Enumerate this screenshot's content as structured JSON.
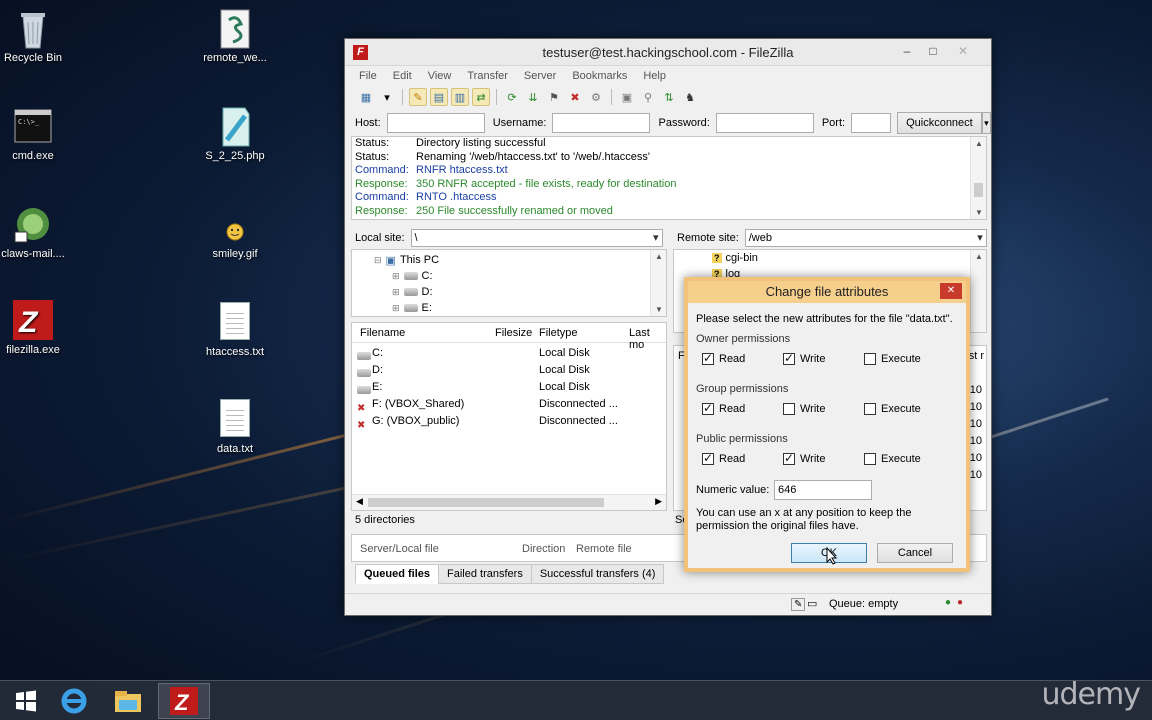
{
  "desktop": {
    "icons": [
      {
        "label": "Recycle Bin",
        "icon": "recycle-bin-icon"
      },
      {
        "label": "remote_we...",
        "icon": "script-file-icon"
      },
      {
        "label": "cmd.exe",
        "icon": "console-icon"
      },
      {
        "label": "S_2_25.php",
        "icon": "php-file-icon"
      },
      {
        "label": "claws-mail....",
        "icon": "mail-client-icon"
      },
      {
        "label": "smiley.gif",
        "icon": "smiley-icon"
      },
      {
        "label": "filezilla.exe",
        "icon": "filezilla-icon"
      },
      {
        "label": "htaccess.txt",
        "icon": "text-file-icon"
      },
      {
        "label": "data.txt",
        "icon": "text-file-icon"
      }
    ]
  },
  "window": {
    "title": "testuser@test.hackingschool.com - FileZilla",
    "menu": [
      "File",
      "Edit",
      "View",
      "Transfer",
      "Server",
      "Bookmarks",
      "Help"
    ],
    "quickconnect": {
      "host_label": "Host:",
      "username_label": "Username:",
      "password_label": "Password:",
      "port_label": "Port:",
      "button": "Quickconnect",
      "host_value": "",
      "username_value": "",
      "password_value": "",
      "port_value": ""
    },
    "log": [
      {
        "key": "Status:",
        "text": "Directory listing successful",
        "kind": "status"
      },
      {
        "key": "Status:",
        "text": "Renaming '/web/htaccess.txt' to '/web/.htaccess'",
        "kind": "status"
      },
      {
        "key": "Command:",
        "text": "RNFR htaccess.txt",
        "kind": "command"
      },
      {
        "key": "Response:",
        "text": "350 RNFR accepted - file exists, ready for destination",
        "kind": "response"
      },
      {
        "key": "Command:",
        "text": "RNTO .htaccess",
        "kind": "command"
      },
      {
        "key": "Response:",
        "text": "250 File successfully renamed or moved",
        "kind": "response"
      }
    ],
    "local": {
      "site_label": "Local site:",
      "site_value": "\\",
      "tree": [
        "This PC",
        "C:",
        "D:",
        "E:"
      ],
      "columns": [
        "Filename",
        "Filesize",
        "Filetype",
        "Last mo"
      ],
      "rows": [
        {
          "name": "C:",
          "type": "Local Disk"
        },
        {
          "name": "D:",
          "type": "Local Disk"
        },
        {
          "name": "E:",
          "type": "Local Disk"
        },
        {
          "name": "F: (VBOX_Shared)",
          "type": "Disconnected ..."
        },
        {
          "name": "G: (VBOX_public)",
          "type": "Disconnected ..."
        }
      ],
      "status": "5 directories"
    },
    "remote": {
      "site_label": "Remote site:",
      "site_value": "/web",
      "tree": [
        "cgi-bin",
        "log"
      ],
      "partial_header": "F",
      "partial_right": "st r",
      "date_fragments": [
        "/10",
        "/10",
        "/10",
        "/10",
        "/10",
        "/10"
      ],
      "status_fragment": "Se"
    },
    "queue": {
      "columns": [
        "Server/Local file",
        "Direction",
        "Remote file"
      ],
      "tabs": [
        "Queued files",
        "Failed transfers",
        "Successful transfers (4)"
      ],
      "status": "Queue: empty"
    }
  },
  "dialog": {
    "title": "Change file attributes",
    "prompt": "Please select the new attributes for the file \"data.txt\".",
    "groups": [
      {
        "label": "Owner permissions",
        "read": true,
        "write": true,
        "execute": false
      },
      {
        "label": "Group permissions",
        "read": true,
        "write": false,
        "execute": false
      },
      {
        "label": "Public permissions",
        "read": true,
        "write": true,
        "execute": false
      }
    ],
    "read_label": "Read",
    "write_label": "Write",
    "execute_label": "Execute",
    "numeric_label": "Numeric value:",
    "numeric_value": "646",
    "hint": "You can use an x at any position to keep the permission the original files have.",
    "ok": "OK",
    "cancel": "Cancel"
  },
  "watermark": "udemy"
}
